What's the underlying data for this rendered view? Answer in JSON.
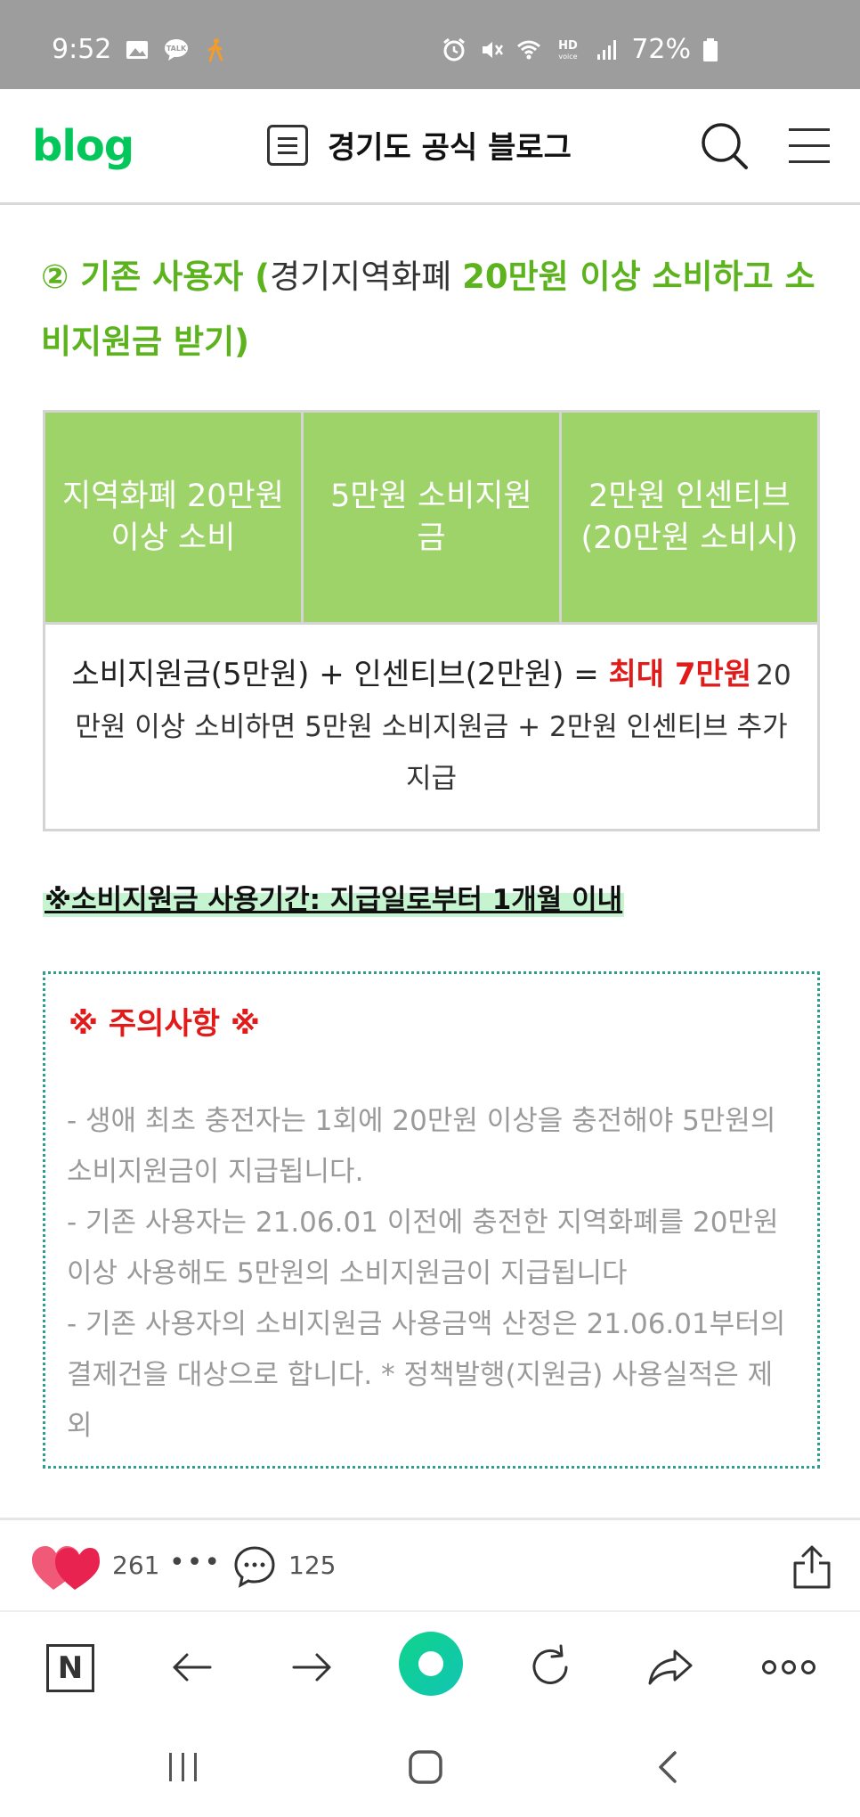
{
  "status_bar": {
    "time": "9:52",
    "battery_text": "72%",
    "icons_left": [
      "image-icon",
      "talk-icon",
      "walking-icon"
    ],
    "icons_right": [
      "alarm-icon",
      "mute-icon",
      "wifi-icon",
      "hd-voice-icon",
      "signal-icon",
      "battery-icon"
    ]
  },
  "header": {
    "logo": "blog",
    "blog_title": "경기도 공식 블로그"
  },
  "content": {
    "heading": {
      "part1": "② 기존 사용자 (",
      "part2": "경기지역화폐 ",
      "part3": "20만원 이상 소비하고 소비지원금 받기)"
    },
    "table": {
      "headers": [
        "지역화폐 20만원 이상 소비",
        "5만원 소비지원금",
        "2만원 인센티브 (20만원 소비시)"
      ],
      "body_main": "소비지원금(5만원) + 인센티브(2만원) = ",
      "body_highlight": "최대 7만원",
      "body_sub": "20만원 이상 소비하면 5만원 소비지원금 + 2만원 인센티브 추가 지급"
    },
    "period_note": "※소비지원금 사용기간: 지급일로부터 1개월 이내",
    "notice": {
      "title": "※ 주의사항 ※",
      "lines": [
        "- 생애 최초 충전자는 1회에 20만원 이상을 충전해야 5만원의 소비지원금이 지급됩니다.",
        "- 기존 사용자는 21.06.01 이전에 충전한 지역화폐를 20만원 이상 사용해도 5만원의 소비지원금이 지급됩니다",
        "- 기존 사용자의 소비지원금 사용금액 산정은 21.06.01부터의 결제건을 대상으로 합니다. * 정책발행(지원금) 사용실적은 제외"
      ]
    }
  },
  "reactions": {
    "likes": "261",
    "more": "•••",
    "comments": "125"
  },
  "browser_nav": {
    "n_label": "N"
  },
  "colors": {
    "accent_green": "#5cb31e",
    "table_header_green": "#9ed36a",
    "naver_green": "#03c75a",
    "alert_red": "#e11a1a"
  }
}
